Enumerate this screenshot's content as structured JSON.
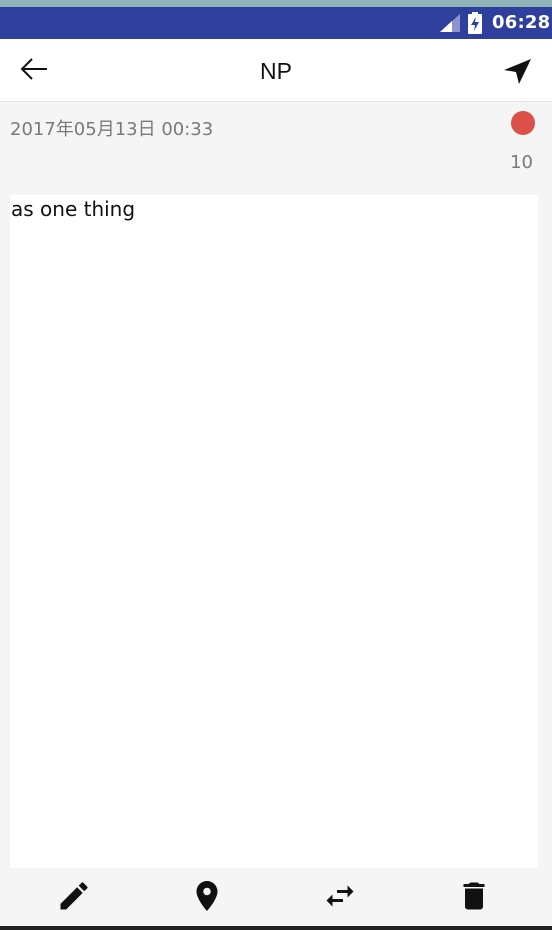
{
  "colors": {
    "status_bar": "#2f3f9e",
    "accent_dot": "#db5149",
    "meta_text": "#7a7a7a"
  },
  "status_bar": {
    "time": "06:28",
    "icons": [
      "signal-icon",
      "battery-charging-icon"
    ]
  },
  "app_bar": {
    "title": "NP",
    "back_icon": "arrow-left-icon",
    "send_icon": "navigation-arrow-icon"
  },
  "note": {
    "date": "2017年05月13日 00:33",
    "char_count": "10",
    "status_dot": "red-dot",
    "text": "as one thing"
  },
  "toolbar": {
    "icons": [
      "pencil-icon",
      "map-pin-icon",
      "swap-arrows-icon",
      "trash-icon"
    ]
  }
}
